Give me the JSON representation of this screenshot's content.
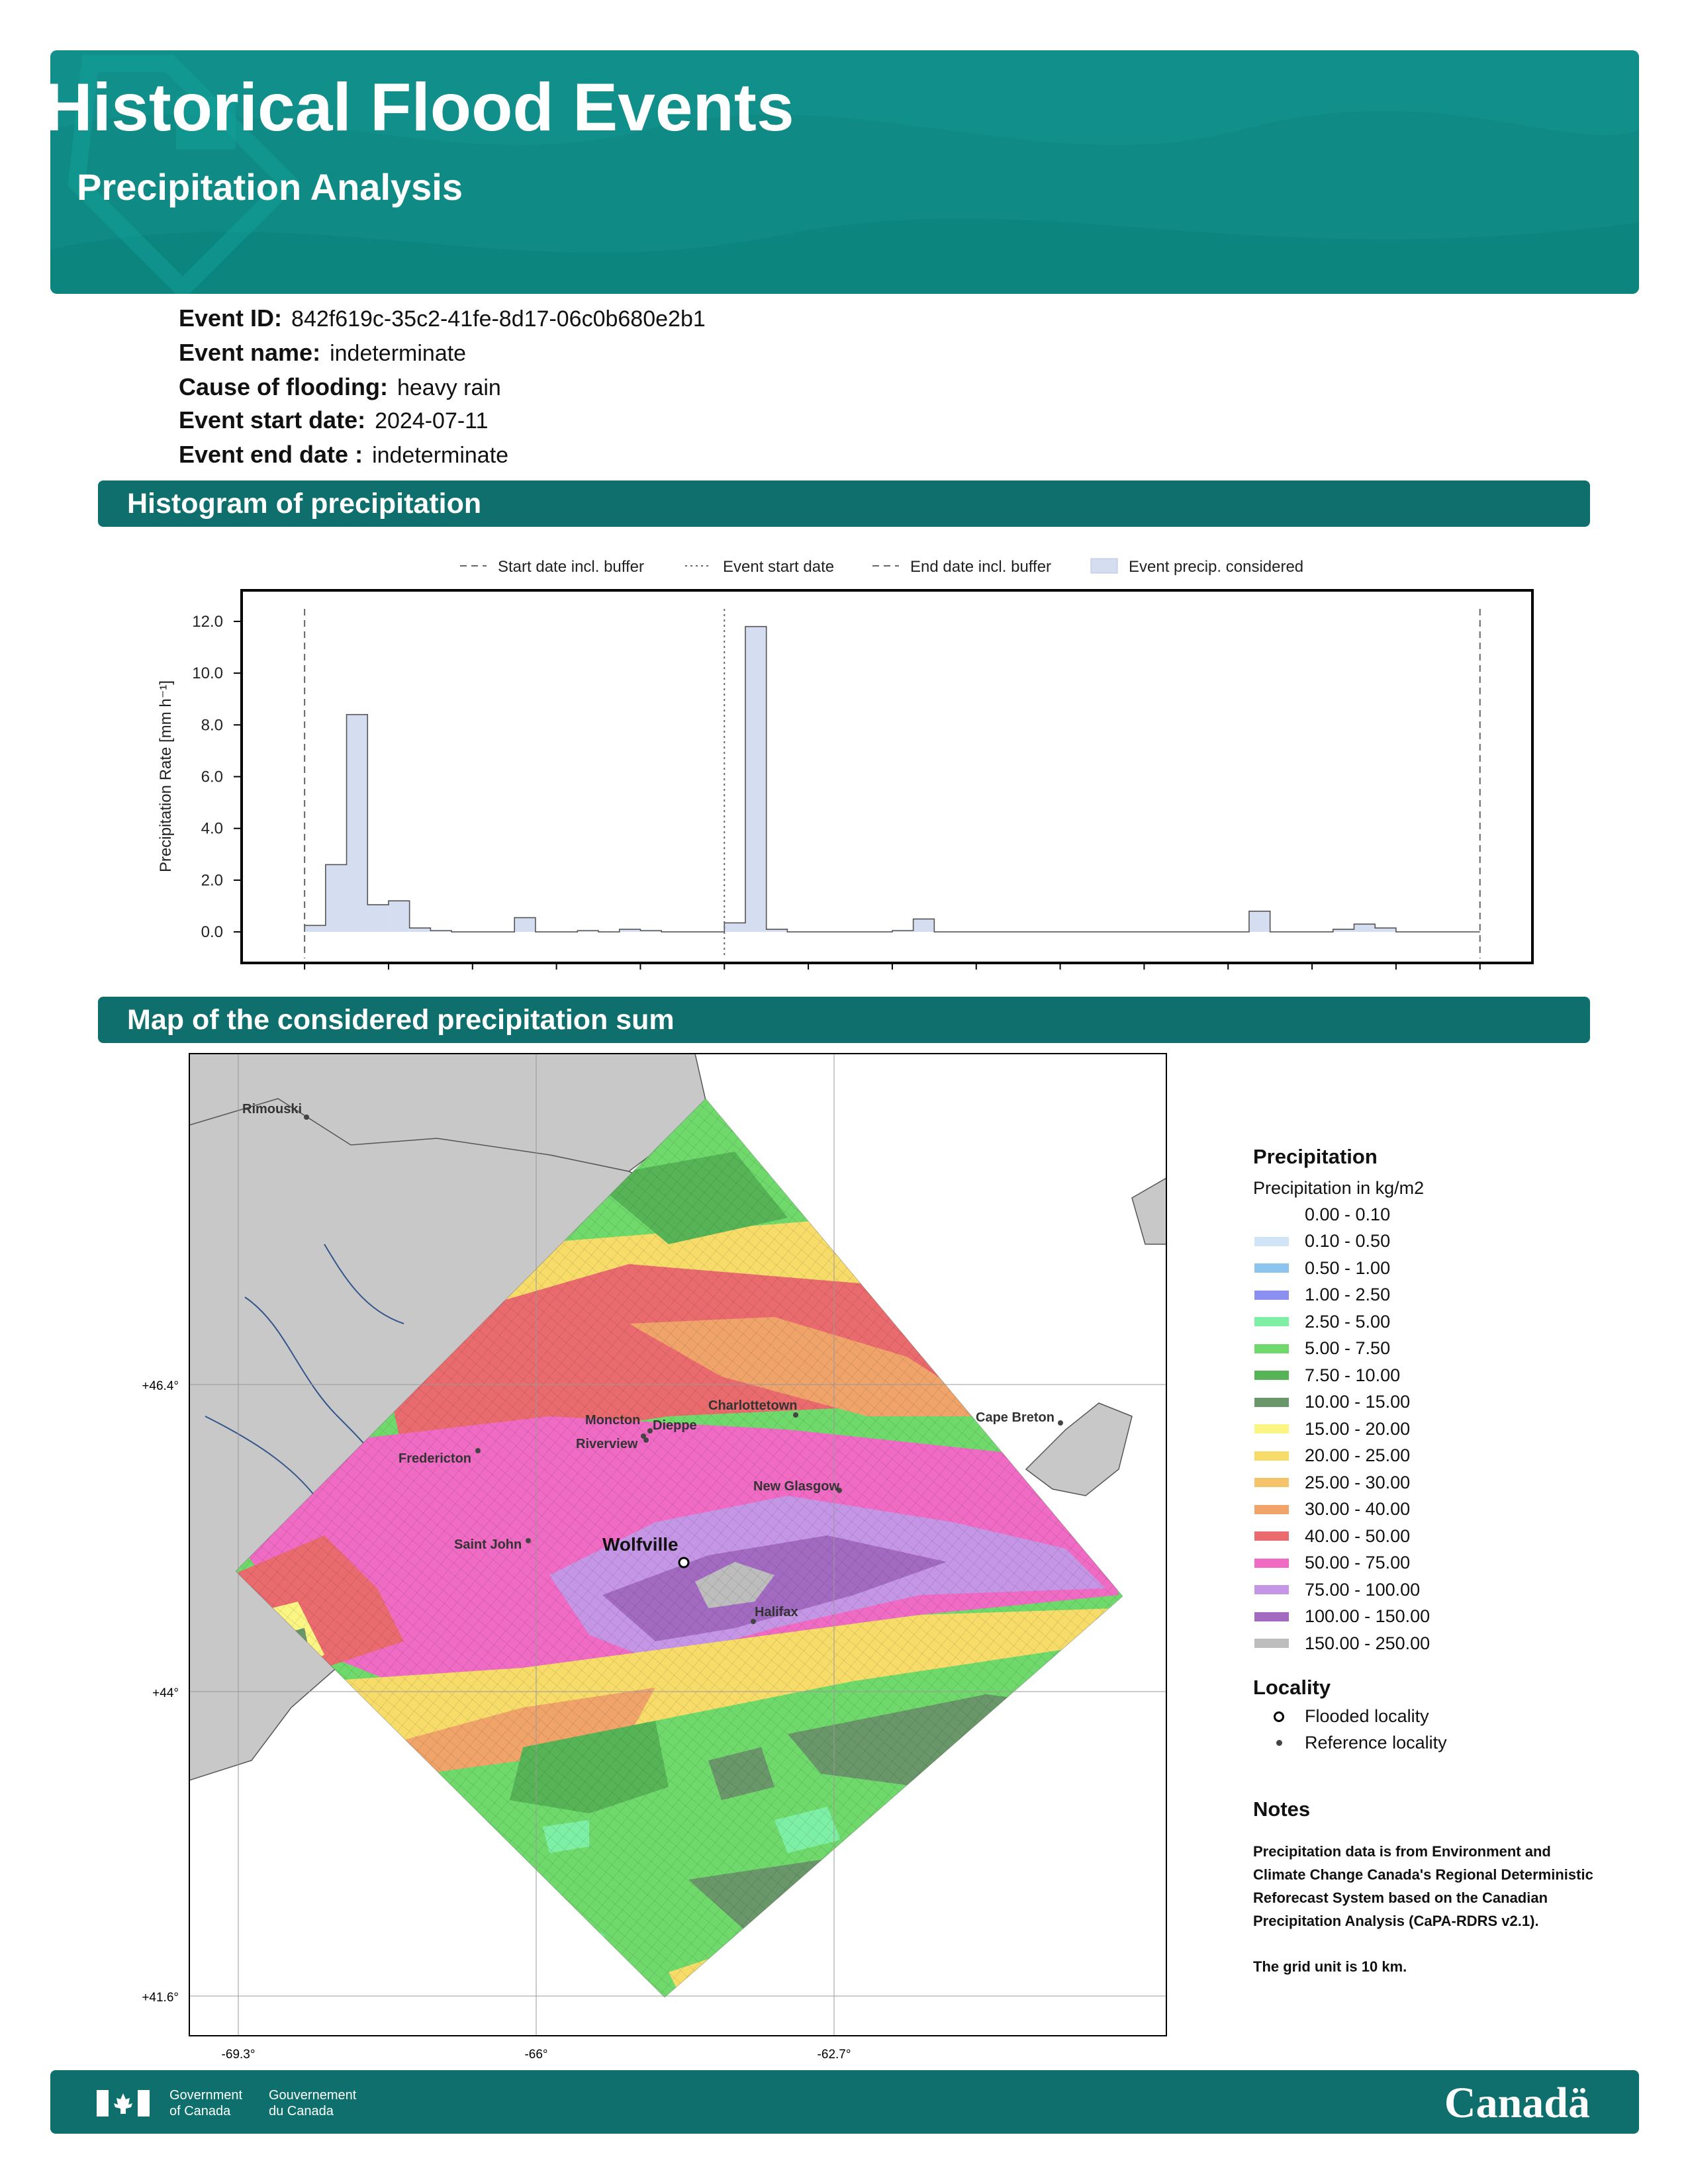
{
  "header": {
    "title": "Historical Flood Events",
    "subtitle": "Precipitation Analysis"
  },
  "event": [
    {
      "label": "Event ID:",
      "value": "842f619c-35c2-41fe-8d17-06c0b680e2b1"
    },
    {
      "label": "Event name:",
      "value": "indeterminate"
    },
    {
      "label": "Cause of flooding:",
      "value": "heavy rain"
    },
    {
      "label": "Event start date:",
      "value": "2024-07-11"
    },
    {
      "label": "Event end date :",
      "value": "indeterminate"
    }
  ],
  "sections": {
    "histogram": "Histogram of precipitation",
    "map": "Map of the considered precipitation sum"
  },
  "chart_data": {
    "type": "bar",
    "ylabel": "Precipitation Rate [mm h⁻¹]",
    "ylim": [
      -1.2,
      13.2
    ],
    "yticks": [
      "0.0",
      "2.0",
      "4.0",
      "6.0",
      "8.0",
      "10.0",
      "12.0"
    ],
    "ytick_values": [
      0,
      2,
      4,
      6,
      8,
      10,
      12
    ],
    "legend": [
      "Start date incl. buffer",
      "Event start date",
      "End date incl. buffer",
      "Event precip. considered"
    ],
    "legend_position": "top",
    "x_range": [
      -4,
      57.5
    ],
    "x_start_buffer": -1,
    "x_event_start": 19,
    "x_end_buffer": 55,
    "values": [
      0.25,
      2.6,
      8.4,
      1.05,
      1.2,
      0.15,
      0.05,
      0,
      0,
      0,
      0.55,
      0,
      0,
      0.05,
      0,
      0.1,
      0.05,
      0,
      0,
      0,
      0.35,
      11.8,
      0.1,
      0,
      0,
      0,
      0,
      0,
      0.05,
      0.5,
      0,
      0,
      0,
      0,
      0,
      0,
      0,
      0,
      0,
      0,
      0,
      0,
      0,
      0,
      0,
      0.8,
      0,
      0,
      0,
      0.1,
      0.3,
      0.15,
      0,
      0,
      0,
      0
    ]
  },
  "map": {
    "latitudes": [
      "+46.4°",
      "+44°",
      "+41.6°"
    ],
    "longitudes": [
      "-69.3°",
      "-66°",
      "-62.7°"
    ],
    "flooded_locality": "Wolfville",
    "reference_localities": [
      "Rimouski",
      "Moncton",
      "Dieppe",
      "Riverview",
      "Charlottetown",
      "Fredericton",
      "Cape Breton",
      "New Glasgow",
      "Saint John",
      "Halifax"
    ]
  },
  "legend": {
    "title": "Precipitation",
    "subtitle": "Precipitation in kg/m2",
    "items": [
      {
        "label": "0.00 - 0.10",
        "color": "#ffffff"
      },
      {
        "label": "0.10 - 0.50",
        "color": "#cfe5f7"
      },
      {
        "label": "0.50 - 1.00",
        "color": "#8cc4f0"
      },
      {
        "label": "1.00 - 2.50",
        "color": "#8a8ff0"
      },
      {
        "label": "2.50 - 5.00",
        "color": "#7ef0a6"
      },
      {
        "label": "5.00 - 7.50",
        "color": "#6fda6b"
      },
      {
        "label": "7.50 - 10.00",
        "color": "#56b457"
      },
      {
        "label": "10.00 - 15.00",
        "color": "#69976a"
      },
      {
        "label": "15.00 - 20.00",
        "color": "#fbf584"
      },
      {
        "label": "20.00 - 25.00",
        "color": "#f7dc6a"
      },
      {
        "label": "25.00 - 30.00",
        "color": "#f5c46a"
      },
      {
        "label": "30.00 - 40.00",
        "color": "#f0a46a"
      },
      {
        "label": "40.00 - 50.00",
        "color": "#ea6b6e"
      },
      {
        "label": "50.00 - 75.00",
        "color": "#ef6bc4"
      },
      {
        "label": "75.00 - 100.00",
        "color": "#c596e6"
      },
      {
        "label": "100.00 - 150.00",
        "color": "#a26bc1"
      },
      {
        "label": "150.00 - 250.00",
        "color": "#bdbdbd"
      }
    ],
    "locality_title": "Locality",
    "flooded_label": "Flooded locality",
    "reference_label": "Reference locality"
  },
  "notes": {
    "title": "Notes",
    "body": "Precipitation data is from Environment and Climate Change Canada's Regional Deterministic Reforecast System based on the Canadian Precipitation Analysis (CaPA-RDRS v2.1).",
    "grid": "The grid unit is 10 km."
  },
  "footer": {
    "gov_en_1": "Government",
    "gov_en_2": "of Canada",
    "gov_fr_1": "Gouvernement",
    "gov_fr_2": "du Canada",
    "wordmark": "Canadä"
  },
  "colors": {
    "brand": "#0f8a85",
    "bar_dark": "#0e6f6c",
    "hist_fill": "#d5def0"
  }
}
